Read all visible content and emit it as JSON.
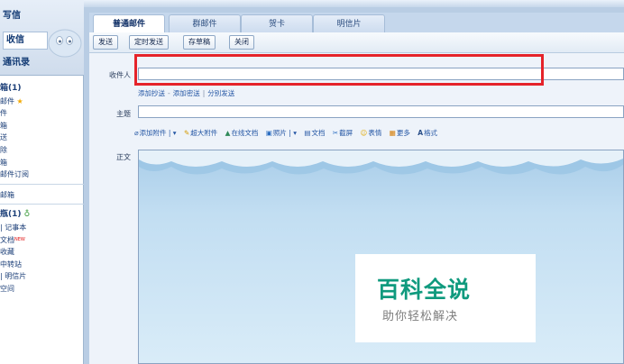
{
  "sidebar": {
    "write": "写信",
    "inbox": "收信",
    "contacts": "通讯录",
    "folders": [
      {
        "label": "箱(1)",
        "bold": true
      },
      {
        "label": "邮件",
        "star": true
      },
      {
        "label": "件"
      },
      {
        "label": "箱"
      },
      {
        "label": "送"
      },
      {
        "label": "除"
      },
      {
        "label": "箱"
      },
      {
        "label": "邮件订阅"
      }
    ],
    "folders2": [
      {
        "label": "邮箱"
      }
    ],
    "folders3": [
      {
        "label": "瓶(1)",
        "bold": true
      },
      {
        "label": "| 记事本"
      },
      {
        "label": "文档",
        "new_tag": "NEW"
      },
      {
        "label": "收藏"
      },
      {
        "label": "中转站"
      },
      {
        "label": "| 明信片"
      },
      {
        "label": "空间"
      }
    ]
  },
  "tabs": [
    "普通邮件",
    "群邮件",
    "贺卡",
    "明信片"
  ],
  "toolbar": {
    "send": "发送",
    "scheduled_send": "定时发送",
    "save_draft": "存草稿",
    "close": "关闭"
  },
  "compose": {
    "recipient_label": "收件人",
    "recipient_value": "",
    "cc_links": [
      "添加抄送",
      "添加密送",
      "分别发送"
    ],
    "subject_label": "主题",
    "subject_value": "",
    "attach_items": [
      "添加附件",
      "超大附件",
      "在线文档",
      "照片",
      "文档",
      "截屏",
      "表情",
      "更多",
      "格式"
    ],
    "body_label": "正文"
  },
  "watermark": {
    "title": "百科全说",
    "subtitle": "助你轻松解决"
  }
}
